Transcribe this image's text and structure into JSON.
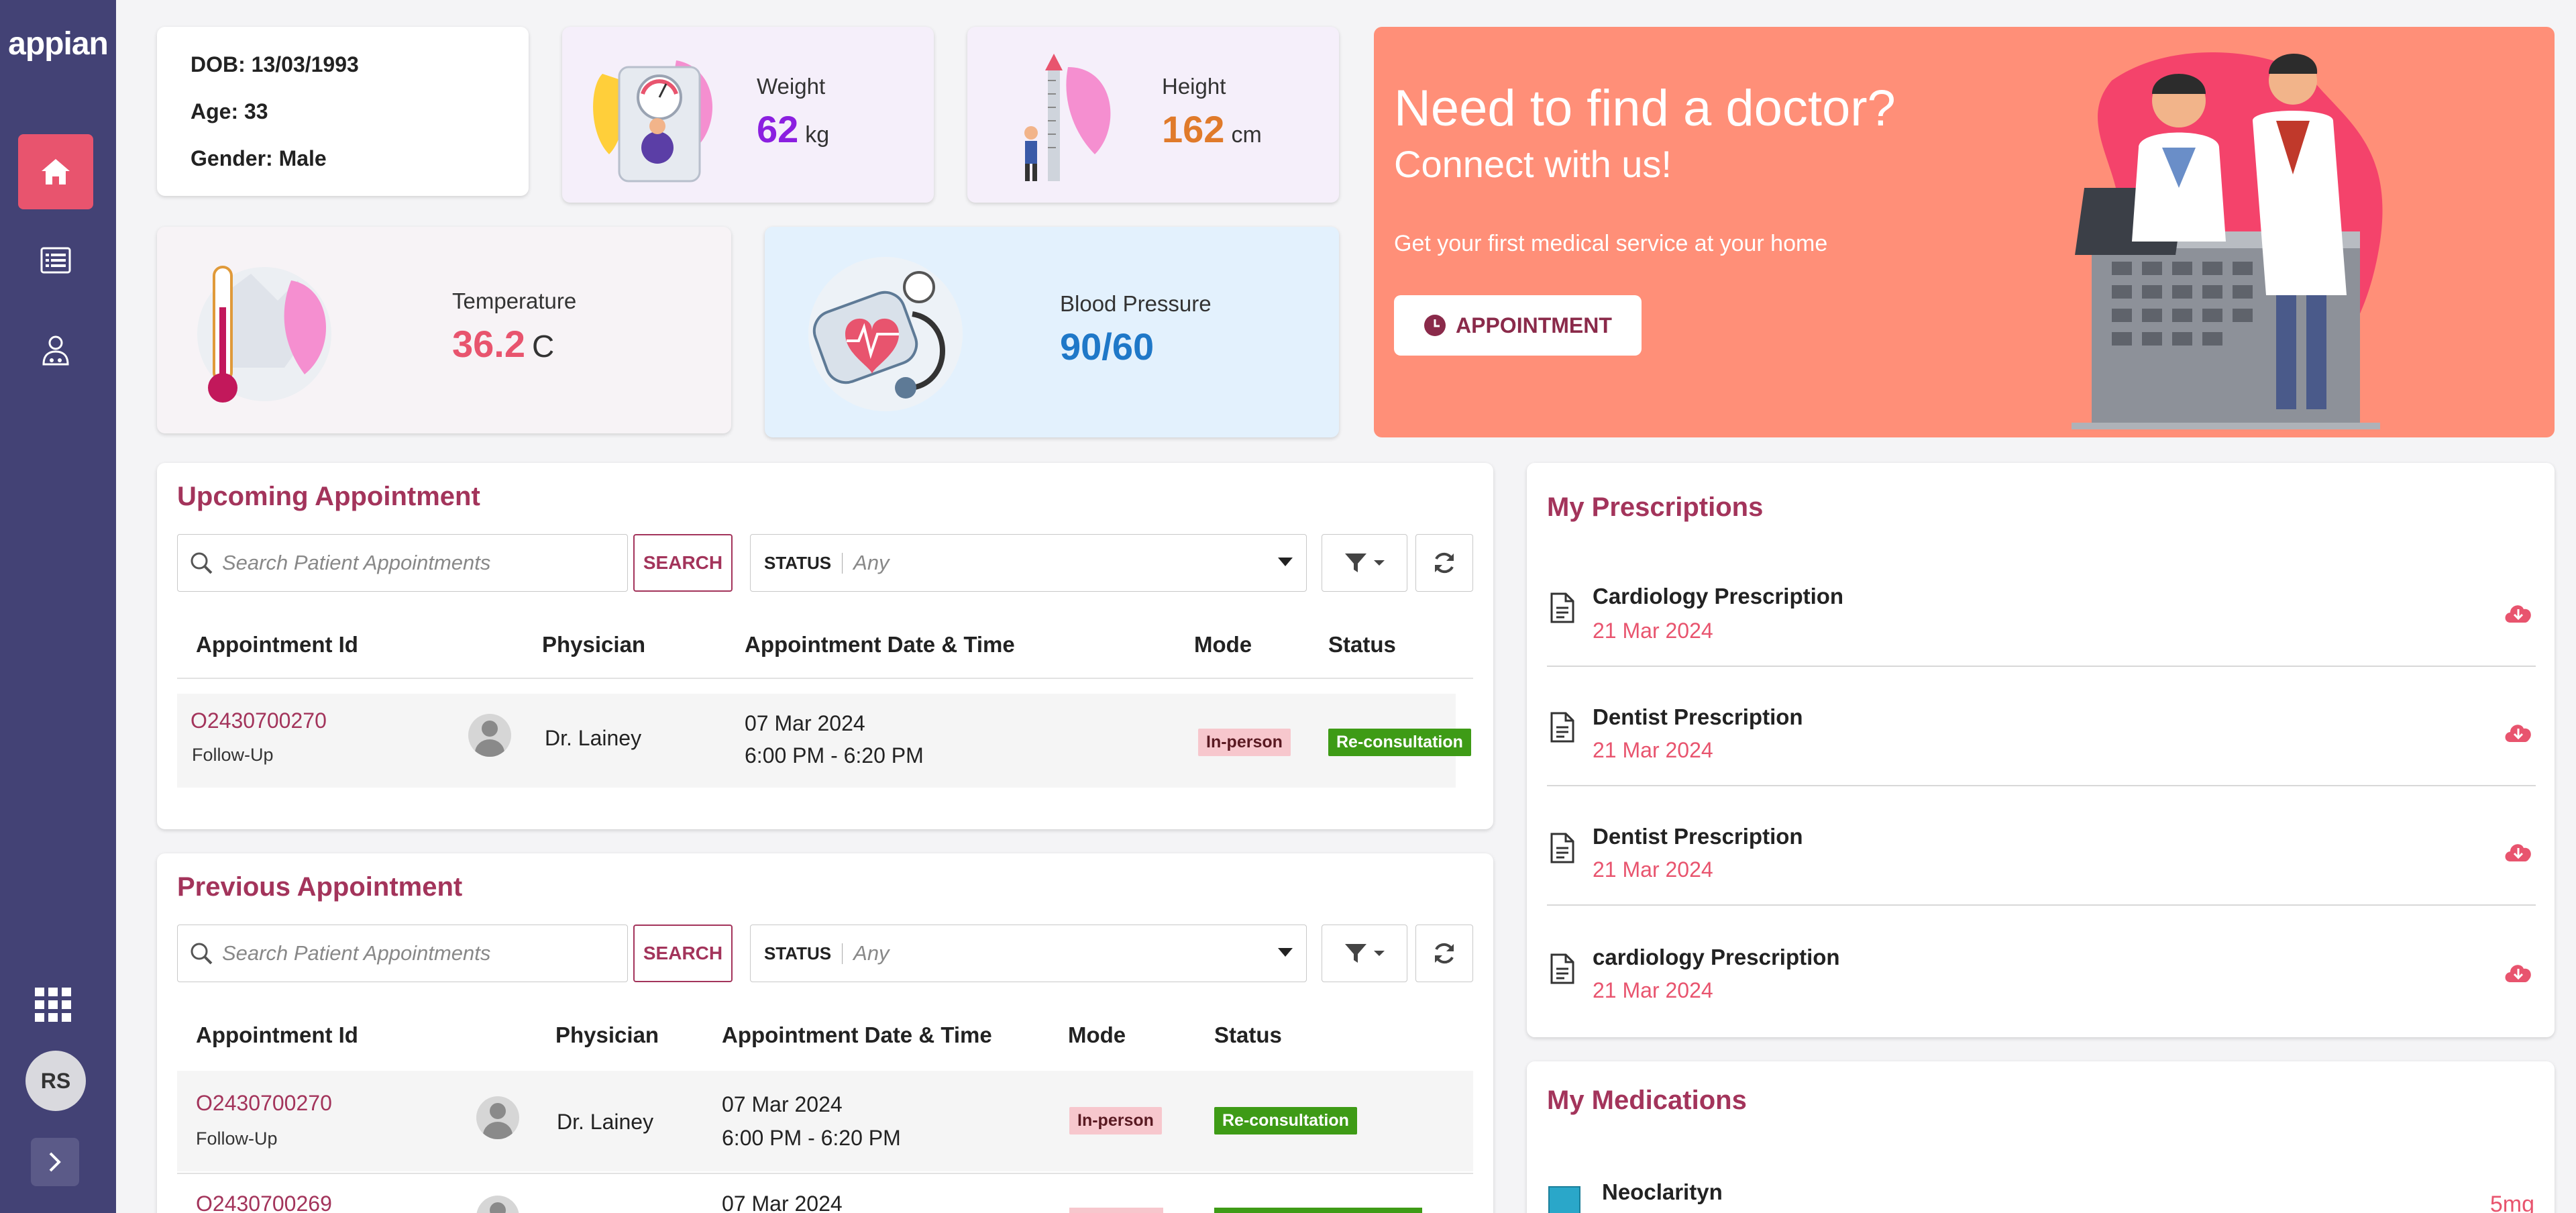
{
  "app": {
    "logo": "appian"
  },
  "sidebar": {
    "items": [
      {
        "name": "home",
        "icon": "home-icon",
        "active": true
      },
      {
        "name": "list",
        "icon": "list-icon",
        "active": false
      },
      {
        "name": "doctor",
        "icon": "doctor-icon",
        "active": false
      }
    ],
    "apps_icon": "apps-grid-icon",
    "user_initials": "RS",
    "expand_icon": "chevron-right-icon"
  },
  "profile": {
    "dob": "DOB: 13/03/1993",
    "age": "Age: 33",
    "gender": "Gender: Male"
  },
  "vitals": {
    "weight": {
      "label": "Weight",
      "value": "62",
      "unit": "kg",
      "color": "#8b1fe0"
    },
    "height": {
      "label": "Height",
      "value": "162",
      "unit": "cm",
      "color": "#e07a2a"
    },
    "temperature": {
      "label": "Temperature",
      "value": "36.2",
      "unit": "C",
      "color": "#e8546e"
    },
    "blood_pressure": {
      "label": "Blood Pressure",
      "value": "90/60",
      "color": "#1f78c8"
    }
  },
  "hero": {
    "title": "Need to find a doctor?",
    "subtitle": "Connect with us!",
    "text": "Get your first medical service at your home",
    "button": "APPOINTMENT",
    "bg_color": "#ff8f78"
  },
  "upcoming": {
    "title": "Upcoming Appointment",
    "search_placeholder": "Search Patient Appointments",
    "search_button": "SEARCH",
    "status_label": "STATUS",
    "status_value": "Any",
    "columns": [
      "Appointment Id",
      "Physician",
      "Appointment Date & Time",
      "Mode",
      "Status"
    ],
    "rows": [
      {
        "id": "O2430700270",
        "type": "Follow-Up",
        "physician": "Dr. Lainey",
        "date": "07 Mar 2024",
        "time": "6:00 PM - 6:20 PM",
        "mode": "In-person",
        "status": "Re-consultation"
      }
    ]
  },
  "previous": {
    "title": "Previous Appointment",
    "search_placeholder": "Search Patient Appointments",
    "search_button": "SEARCH",
    "status_label": "STATUS",
    "status_value": "Any",
    "columns": [
      "Appointment Id",
      "Physician",
      "Appointment Date & Time",
      "Mode",
      "Status"
    ],
    "rows": [
      {
        "id": "O2430700270",
        "type": "Follow-Up",
        "physician": "Dr. Lainey",
        "date": "07 Mar 2024",
        "time": "6:00 PM - 6:20 PM",
        "mode": "In-person",
        "status": "Re-consultation"
      },
      {
        "id": "O2430700269",
        "date": "07 Mar 2024"
      }
    ]
  },
  "prescriptions": {
    "title": "My Prescriptions",
    "items": [
      {
        "name": "Cardiology Prescription",
        "date": "21 Mar 2024"
      },
      {
        "name": "Dentist Prescription",
        "date": "21 Mar 2024"
      },
      {
        "name": "Dentist Prescription",
        "date": "21 Mar 2024"
      },
      {
        "name": "cardiology Prescription",
        "date": "21 Mar 2024"
      }
    ]
  },
  "medications": {
    "title": "My Medications",
    "items": [
      {
        "name": "Neoclarityn",
        "dose": "5mg"
      }
    ]
  },
  "colors": {
    "sidebar": "#434275",
    "accent": "#a3345b",
    "active_nav": "#e8546e",
    "status_green": "#3e9b16",
    "mode_pink": "#f7c7cd"
  }
}
